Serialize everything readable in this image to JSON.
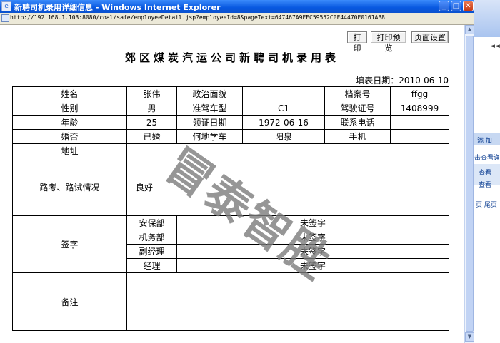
{
  "window": {
    "title": "新聘司机录用详细信息 - Windows Internet Explorer",
    "url": "http://192.168.1.103:8080/coal/safe/employeeDetail.jsp?employeeId=8&pageText=647467A9FEC59552C0F44470E0161AB8",
    "minimize": "_",
    "maximize": "□",
    "close": "✕"
  },
  "toolbar": {
    "print": "打印",
    "print_preview": "打印预览",
    "page_setup": "页面设置"
  },
  "document": {
    "title": "郊区煤炭汽运公司新聘司机录用表",
    "fill_date": "填表日期：2010-06-10"
  },
  "form": {
    "name_label": "姓名",
    "name": "张伟",
    "political_label": "政治面貌",
    "political": "",
    "file_no_label": "档案号",
    "file_no": "ffgg",
    "gender_label": "性别",
    "gender": "男",
    "vehicle_label": "准驾车型",
    "vehicle": "C1",
    "license_no_label": "驾驶证号",
    "license_no": "1408999",
    "age_label": "年龄",
    "age": "25",
    "license_date_label": "领证日期",
    "license_date": "1972-06-16",
    "phone_label": "联系电话",
    "phone": "",
    "married_label": "婚否",
    "married": "已婚",
    "school_label": "何地学车",
    "school": "阳泉",
    "mobile_label": "手机",
    "mobile": "",
    "address_label": "地址",
    "address": "",
    "exam_label": "路考、路试情况",
    "exam": "良好",
    "sign_label": "签字",
    "signatures": [
      {
        "dept": "安保部",
        "status": "未签字"
      },
      {
        "dept": "机务部",
        "status": "未签字"
      },
      {
        "dept": "副经理",
        "status": "未签字"
      },
      {
        "dept": "经理",
        "status": "未签字"
      }
    ],
    "remarks_label": "备注",
    "remarks": ""
  },
  "watermark": "冒泰智胜",
  "background_window": {
    "items": [
      "添 加",
      "击查看详细",
      "查看",
      "查看",
      "页 尾页"
    ]
  }
}
